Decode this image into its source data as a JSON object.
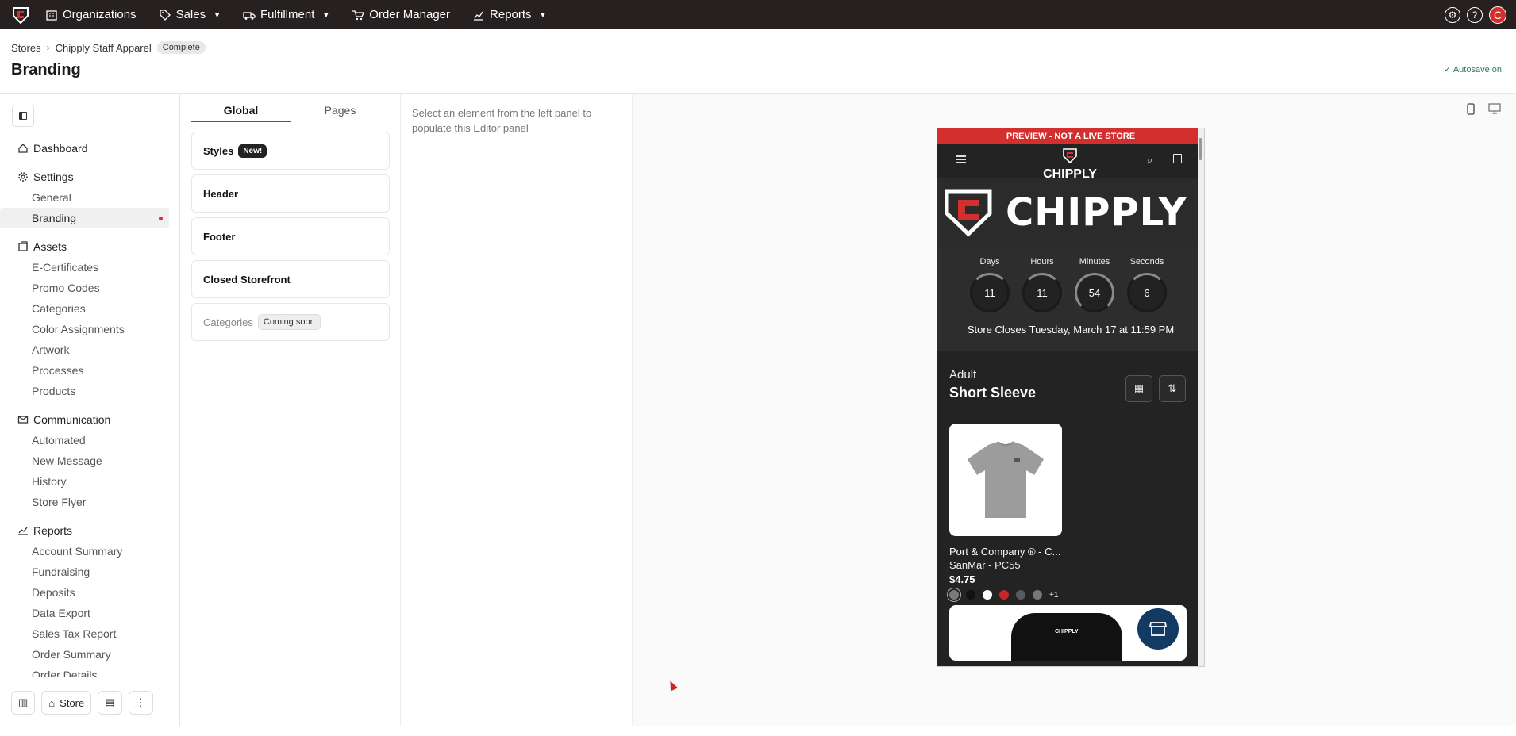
{
  "topnav": {
    "items": [
      {
        "label": "Organizations",
        "icon": "building-icon",
        "dropdown": false
      },
      {
        "label": "Sales",
        "icon": "tag-icon",
        "dropdown": true
      },
      {
        "label": "Fulfillment",
        "icon": "truck-icon",
        "dropdown": true
      },
      {
        "label": "Order Manager",
        "icon": "cart-icon",
        "dropdown": false
      },
      {
        "label": "Reports",
        "icon": "chart-icon",
        "dropdown": true
      }
    ],
    "avatar_letter": "C"
  },
  "breadcrumb": {
    "root": "Stores",
    "store": "Chipply Staff Apparel",
    "status": "Complete"
  },
  "page_title": "Branding",
  "autosave": "Autosave on",
  "sidebar": {
    "dashboard": "Dashboard",
    "settings": {
      "label": "Settings",
      "items": [
        "General",
        "Branding"
      ]
    },
    "assets": {
      "label": "Assets",
      "items": [
        "E-Certificates",
        "Promo Codes",
        "Categories",
        "Color Assignments",
        "Artwork",
        "Processes",
        "Products"
      ]
    },
    "communication": {
      "label": "Communication",
      "items": [
        "Automated",
        "New Message",
        "History",
        "Store Flyer"
      ]
    },
    "reports": {
      "label": "Reports",
      "items": [
        "Account Summary",
        "Fundraising",
        "Deposits",
        "Data Export",
        "Sales Tax Report",
        "Order Summary",
        "Order Details"
      ]
    },
    "footer": {
      "store_label": "Store"
    }
  },
  "panel": {
    "tabs": [
      "Global",
      "Pages"
    ],
    "cards": {
      "styles": "Styles",
      "styles_badge": "New!",
      "header": "Header",
      "footer": "Footer",
      "closed": "Closed Storefront",
      "categories": "Categories",
      "categories_badge": "Coming soon"
    }
  },
  "editor": {
    "hint": "Select an element from the left panel to populate this Editor panel"
  },
  "preview": {
    "banner": "PREVIEW - NOT A LIVE STORE",
    "logo_word": "CHIPPLY",
    "hero_word": "CHIPPLY",
    "countdown": {
      "days_label": "Days",
      "days": "11",
      "hours_label": "Hours",
      "hours": "11",
      "minutes_label": "Minutes",
      "minutes": "54",
      "seconds_label": "Seconds",
      "seconds": "6",
      "closes": "Store Closes Tuesday, March 17 at 11:59 PM"
    },
    "category_label": "Adult",
    "category_title": "Short Sleeve",
    "product": {
      "name": "Port & Company ® - C...",
      "sku": "SanMar - PC55",
      "price": "$4.75",
      "swatches": [
        "#7a7a7a",
        "#111111",
        "#ffffff",
        "#c62828",
        "#5a5a5a",
        "#777777"
      ],
      "more": "+1"
    },
    "product2_logo": "CHIPPLY"
  },
  "colors": {
    "topbar": "#262020",
    "accent": "#c62828",
    "autosave": "#2e7d5b"
  }
}
